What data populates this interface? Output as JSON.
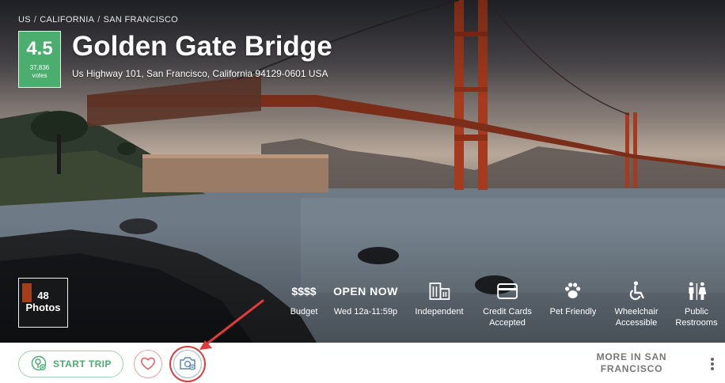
{
  "breadcrumb": [
    {
      "label": "US"
    },
    {
      "label": "CALIFORNIA"
    },
    {
      "label": "SAN FRANCISCO"
    }
  ],
  "rating": {
    "score": "4.5",
    "votes": "37,836",
    "votes_unit": "votes"
  },
  "place": {
    "title": "Golden Gate Bridge",
    "address": "Us Highway 101, San Francisco, California 94129-0601 USA"
  },
  "photos": {
    "count": "48",
    "label": "Photos"
  },
  "features": [
    {
      "icon": "price-icon",
      "value": "$$$$",
      "label": "Budget"
    },
    {
      "icon": "hours",
      "value": "OPEN NOW",
      "label": "Wed 12a-11:59p"
    },
    {
      "icon": "building-icon",
      "label": "Independent"
    },
    {
      "icon": "credit-card-icon",
      "label_line1": "Credit Cards",
      "label_line2": "Accepted"
    },
    {
      "icon": "paw-icon",
      "label": "Pet Friendly"
    },
    {
      "icon": "wheelchair-icon",
      "label_line1": "Wheelchair",
      "label_line2": "Accessible"
    },
    {
      "icon": "restroom-icon",
      "label_line1": "Public",
      "label_line2": "Restrooms"
    }
  ],
  "actions": {
    "start_trip": "START TRIP",
    "more_in_line1": "MORE IN SAN",
    "more_in_line2": "FRANCISCO"
  },
  "colors": {
    "green": "#4cae6e",
    "red": "#e03b3b",
    "blue": "#5b8ab5"
  }
}
